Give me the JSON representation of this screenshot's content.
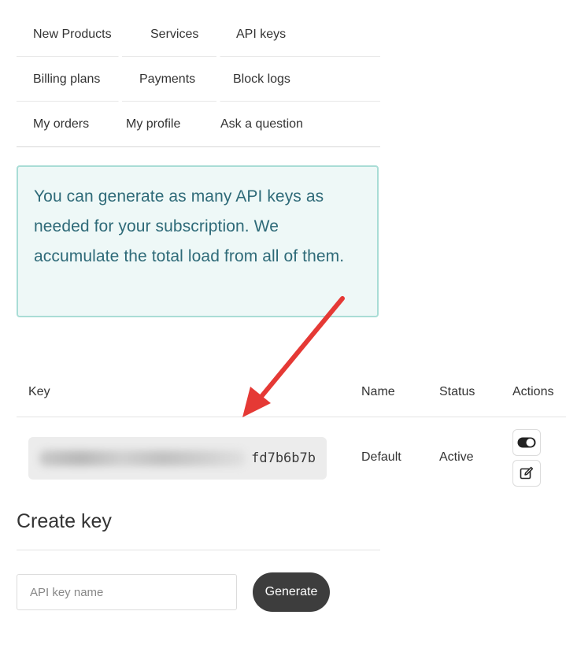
{
  "nav": {
    "rows": [
      [
        "New Products",
        "Services",
        "API keys"
      ],
      [
        "Billing plans",
        "Payments",
        "Block logs"
      ],
      [
        "My orders",
        "My profile",
        "Ask a question"
      ]
    ]
  },
  "info": {
    "text": "You can generate as many API keys as needed for your subscription.  We accumulate the total load from all of them."
  },
  "table": {
    "headers": {
      "key": "Key",
      "name": "Name",
      "status": "Status",
      "actions": "Actions"
    },
    "rows": [
      {
        "key_visible_suffix": "fd7b6b7b",
        "key_obscured": true,
        "name": "Default",
        "status": "Active"
      }
    ]
  },
  "create": {
    "title": "Create key",
    "input_placeholder": "API key name",
    "input_value": "",
    "button_label": "Generate"
  },
  "icons": {
    "toggle": "toggle-on-icon",
    "edit": "edit-icon",
    "annotation_arrow": "red-arrow"
  },
  "colors": {
    "accent_dark": "#3d3d3d",
    "info_border": "#a9ddd6",
    "info_bg": "#eef8f7",
    "info_text": "#2e6a78",
    "arrow": "#e53935"
  }
}
